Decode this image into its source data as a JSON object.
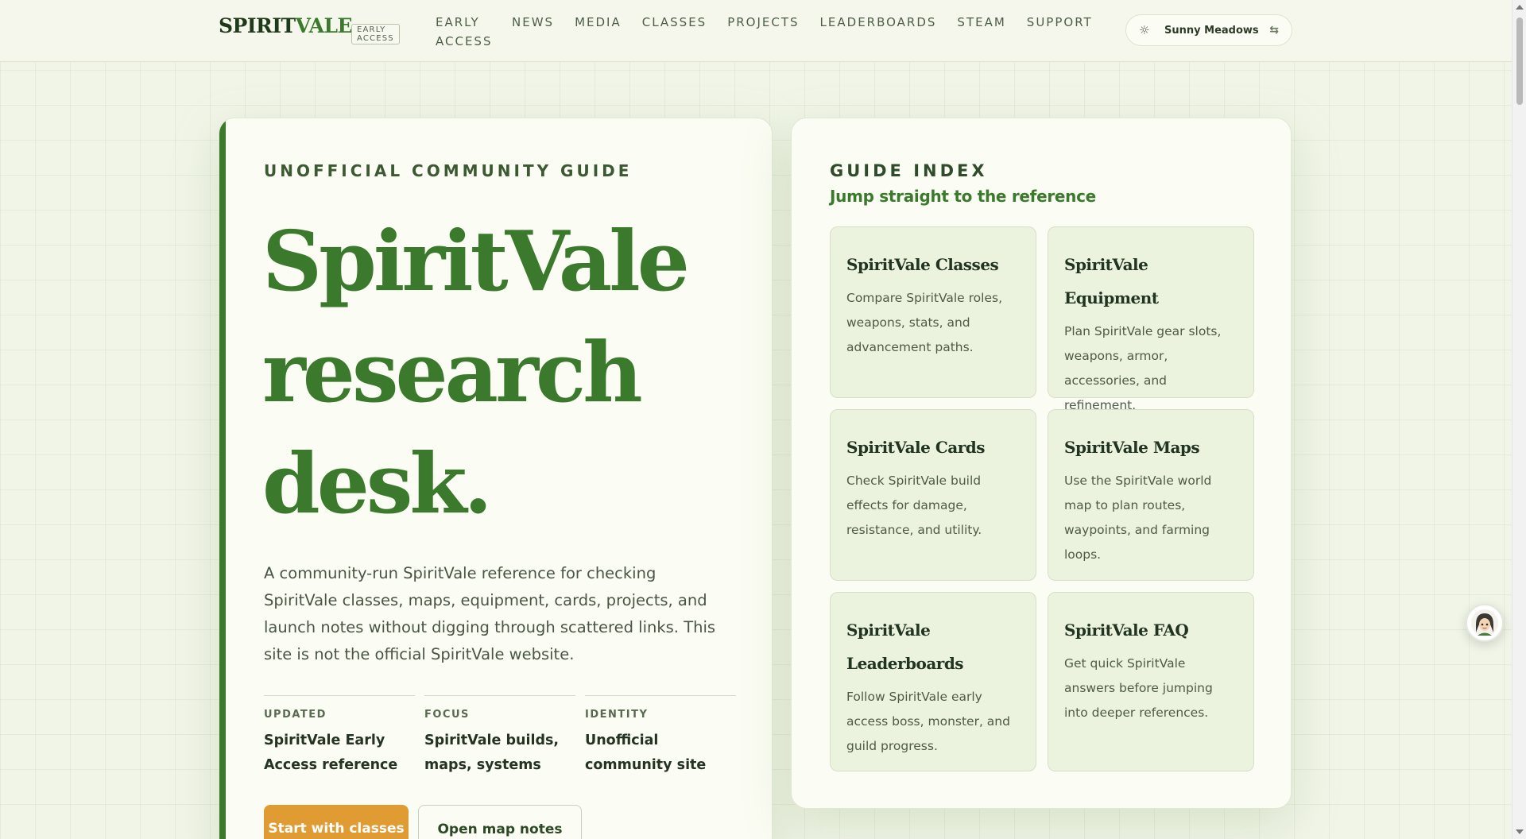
{
  "header": {
    "brand_primary": "SPIRIT",
    "brand_secondary": "VALE",
    "badge": "EARLY ACCESS",
    "nav": [
      "EARLY ACCESS",
      "NEWS",
      "MEDIA",
      "CLASSES",
      "PROJECTS",
      "LEADERBOARDS",
      "STEAM",
      "SUPPORT"
    ],
    "theme_label": "Sunny Meadows",
    "theme_icon": "sun-icon",
    "swap_icon": "swap-icon"
  },
  "hero": {
    "eyebrow": "UNOFFICIAL COMMUNITY GUIDE",
    "title": "SpiritVale research desk.",
    "description": "A community-run SpiritVale reference for checking SpiritVale classes, maps, equipment, cards, projects, and launch notes without digging through scattered links. This site is not the official SpiritVale website.",
    "meta": [
      {
        "label": "UPDATED",
        "value": "SpiritVale Early Access reference"
      },
      {
        "label": "FOCUS",
        "value": "SpiritVale builds, maps, systems"
      },
      {
        "label": "IDENTITY",
        "value": "Unofficial community site"
      }
    ],
    "primary_button": "Start with classes",
    "secondary_button": "Open map notes"
  },
  "guide": {
    "eyebrow": "GUIDE INDEX",
    "subtitle": "Jump straight to the reference",
    "cards": [
      {
        "title": "SpiritVale Classes",
        "desc": "Compare SpiritVale roles, weapons, stats, and advancement paths."
      },
      {
        "title": "SpiritVale Equipment",
        "desc": "Plan SpiritVale gear slots, weapons, armor, accessories, and refinement."
      },
      {
        "title": "SpiritVale Cards",
        "desc": "Check SpiritVale build effects for damage, resistance, and utility."
      },
      {
        "title": "SpiritVale Maps",
        "desc": "Use the SpiritVale world map to plan routes, waypoints, and farming loops."
      },
      {
        "title": "SpiritVale Leaderboards",
        "desc": "Follow SpiritVale early access boss, monster, and guild progress."
      },
      {
        "title": "SpiritVale FAQ",
        "desc": "Get quick SpiritVale answers before jumping into deeper references."
      }
    ]
  },
  "colors": {
    "accent_green": "#3b7a2c",
    "button_orange": "#e09c33",
    "card_green": "#ebf2dd"
  }
}
